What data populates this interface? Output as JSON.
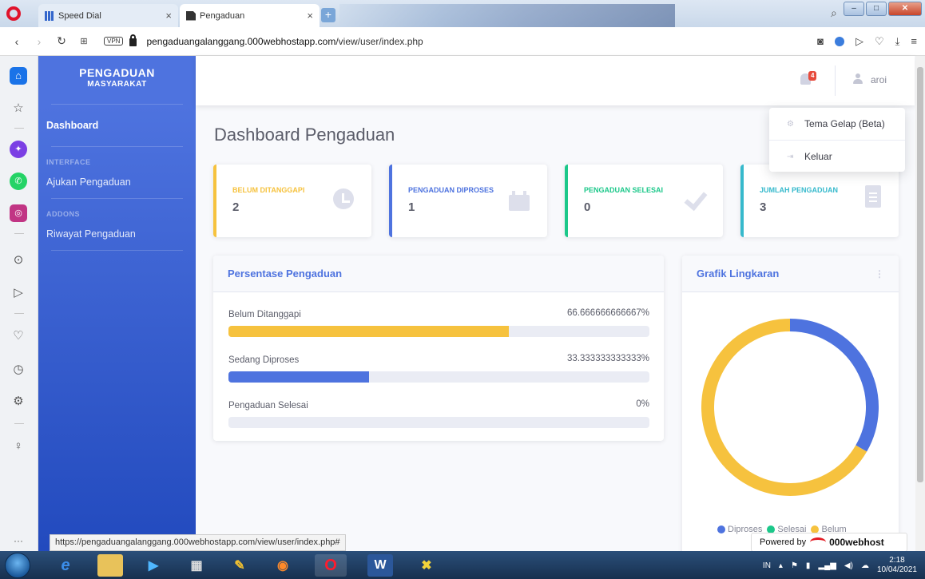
{
  "browser": {
    "tabs": [
      {
        "label": "Speed Dial",
        "close": "×"
      },
      {
        "label": "Pengaduan",
        "close": "×"
      }
    ],
    "new_tab": "+",
    "vpn": "VPN",
    "url_host": "pengaduangalanggang.000webhostapp.com",
    "url_path": "/view/user/index.php",
    "status_url": "https://pengaduangalanggang.000webhostapp.com/view/user/index.php#"
  },
  "sidebar": {
    "brand_line1": "PENGADUAN",
    "brand_line2": "MASYARAKAT",
    "dashboard": "Dashboard",
    "heading_interface": "INTERFACE",
    "ajukan": "Ajukan Pengaduan",
    "heading_addons": "ADDONS",
    "riwayat": "Riwayat Pengaduan"
  },
  "topbar": {
    "notification_count": "4",
    "user_name": "aroi"
  },
  "dropdown": {
    "theme": "Tema Gelap (Beta)",
    "logout": "Keluar"
  },
  "page": {
    "title": "Dashboard Pengaduan"
  },
  "stats": [
    {
      "label": "BELUM DITANGGAPI",
      "value": "2",
      "color": "#f6c23e",
      "icon": "clock-icon"
    },
    {
      "label": "PENGADUAN DIPROSES",
      "value": "1",
      "color": "#4e73df",
      "icon": "calendar-icon"
    },
    {
      "label": "PENGADUAN SELESAI",
      "value": "0",
      "color": "#1cc88a",
      "icon": "check-icon"
    },
    {
      "label": "JUMLAH PENGADUAN",
      "value": "3",
      "color": "#36b9cc",
      "icon": "clipboard-icon"
    }
  ],
  "progress_card": {
    "title": "Persentase Pengaduan",
    "items": [
      {
        "label": "Belum Ditanggapi",
        "value_text": "66.666666666667%",
        "fraction": 0.6667,
        "color": "#f6c23e"
      },
      {
        "label": "Sedang Diproses",
        "value_text": "33.333333333333%",
        "fraction": 0.3333,
        "color": "#4e73df"
      },
      {
        "label": "Pengaduan Selesai",
        "value_text": "0%",
        "fraction": 0,
        "color": "#1cc88a"
      }
    ]
  },
  "donut_card": {
    "title": "Grafik Lingkaran",
    "menu": "⋮"
  },
  "chart_data": {
    "type": "pie",
    "categories": [
      "Diproses",
      "Selesai",
      "Belum"
    ],
    "values": [
      1,
      0,
      2
    ],
    "colors": [
      "#4e73df",
      "#1cc88a",
      "#f6c23e"
    ],
    "title": "Grafik Lingkaran",
    "legend": "bottom"
  },
  "footer": {
    "powered_by": "Powered by",
    "powered_brand": "000webhost"
  },
  "taskbar": {
    "lang": "IN",
    "time": "2:18",
    "date": "10/04/2021"
  }
}
